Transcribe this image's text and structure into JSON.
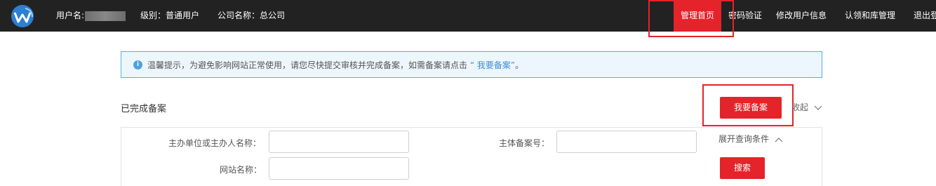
{
  "header": {
    "username_label": "用户名:",
    "level_label": "级别：普通用户",
    "company_label": "公司名称：总公司",
    "nav": [
      "管理首页",
      "密码验证",
      "修改用户信息",
      "认领和库管理",
      "退出登"
    ]
  },
  "notice": {
    "prefix": "温馨提示，为避免影响网站正常使用，请您尽快提交审核并完成备案，如需备案请点击",
    "link": "“ 我要备案”",
    "suffix": "。"
  },
  "section": {
    "title": "已完成备案",
    "apply_button": "我要备案",
    "collapse_label": "收起"
  },
  "search": {
    "sponsor_label": "主办单位或主办人名称：",
    "record_no_label": "主体备案号：",
    "site_name_label": "网站名称：",
    "expand_label": "展开查询条件",
    "search_button": "搜索"
  },
  "colors": {
    "accent": "#e5232a",
    "topbar": "#222222",
    "info": "#5aaede"
  }
}
